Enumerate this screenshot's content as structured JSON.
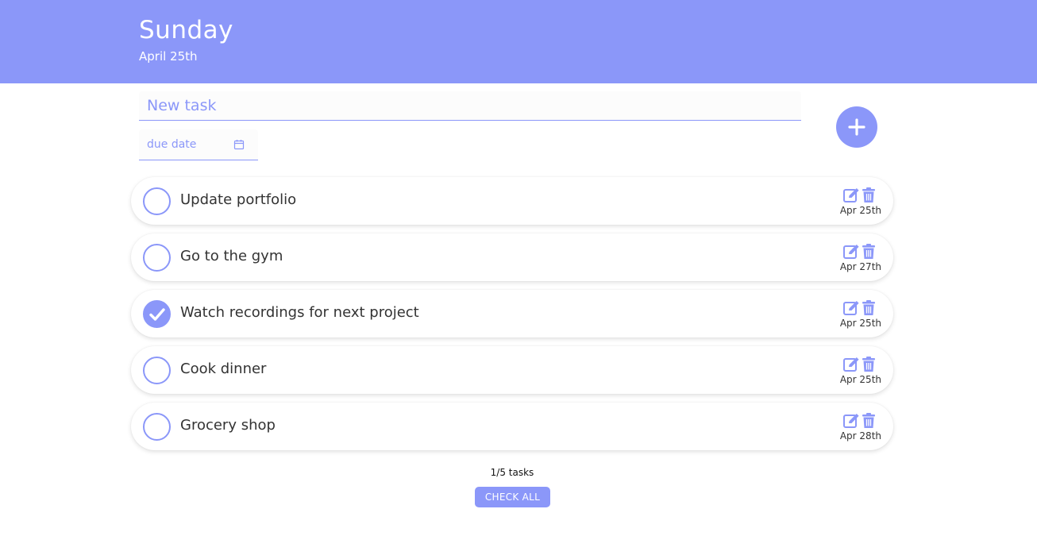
{
  "header": {
    "day": "Sunday",
    "date": "April 25th",
    "color": "#8b97f9"
  },
  "new_task": {
    "placeholder": "New task",
    "value": ""
  },
  "due_date": {
    "placeholder": "due date",
    "icon": "calendar-icon"
  },
  "add_button": {
    "icon": "plus-icon"
  },
  "tasks": [
    {
      "text": "Update portfolio",
      "due": "Apr 25th",
      "done": false
    },
    {
      "text": "Go to the gym",
      "due": "Apr 27th",
      "done": false
    },
    {
      "text": "Watch recordings for next project",
      "due": "Apr 25th",
      "done": true
    },
    {
      "text": "Cook dinner",
      "due": "Apr 25th",
      "done": false
    },
    {
      "text": "Grocery shop",
      "due": "Apr 28th",
      "done": false
    }
  ],
  "task_icons": {
    "edit": "edit-icon",
    "delete": "trash-icon"
  },
  "footer": {
    "summary": "1/5 tasks",
    "check_all_label": "CHECK ALL"
  }
}
